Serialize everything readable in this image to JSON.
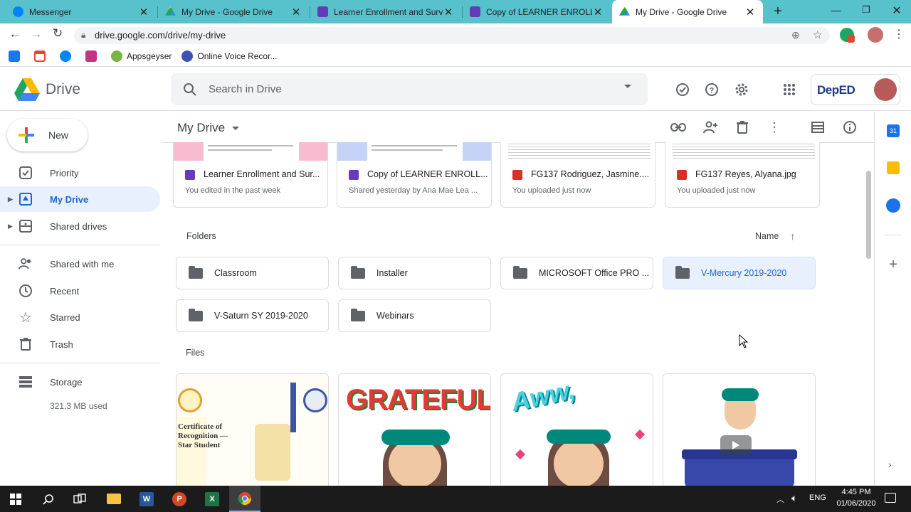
{
  "browser": {
    "tabs": [
      {
        "title": "Messenger",
        "icon": "messenger-icon",
        "color": "#0084ff"
      },
      {
        "title": "My Drive - Google Drive",
        "icon": "drive-icon",
        "color": "#1fa463"
      },
      {
        "title": "Learner Enrollment and Survey",
        "icon": "forms-icon",
        "color": "#673ab7"
      },
      {
        "title": "Copy of LEARNER ENROLLMEN",
        "icon": "forms-icon",
        "color": "#673ab7"
      },
      {
        "title": "My Drive - Google Drive",
        "icon": "drive-icon",
        "color": "#1fa463"
      }
    ],
    "url": "drive.google.com/drive/my-drive",
    "bookmarks": [
      {
        "label": "",
        "icon": "facebook-icon",
        "color": "#1877f2"
      },
      {
        "label": "",
        "icon": "gmail-icon",
        "color": "#ea4335"
      },
      {
        "label": "",
        "icon": "messenger-icon",
        "color": "#0084ff"
      },
      {
        "label": "",
        "icon": "instagram-icon",
        "color": "#c13584"
      },
      {
        "label": "Appsgeyser",
        "icon": "appsgeyser-icon",
        "color": "#7cb342"
      },
      {
        "label": "Online Voice Recor...",
        "icon": "recorder-icon",
        "color": "#3f51b5"
      }
    ]
  },
  "drive": {
    "logo_label": "Drive",
    "search_placeholder": "Search in Drive",
    "account_label": "DepED",
    "new_label": "New",
    "nav": [
      {
        "label": "Priority",
        "icon": "priority-icon"
      },
      {
        "label": "My Drive",
        "icon": "my-drive-icon"
      },
      {
        "label": "Shared drives",
        "icon": "shared-drives-icon"
      },
      {
        "label": "Shared with me",
        "icon": "shared-with-me-icon"
      },
      {
        "label": "Recent",
        "icon": "clock-icon"
      },
      {
        "label": "Starred",
        "icon": "star-icon"
      },
      {
        "label": "Trash",
        "icon": "trash-icon"
      }
    ],
    "storage_label": "Storage",
    "storage_used": "321.3 MB used",
    "location_title": "My Drive",
    "suggested": [
      {
        "name": "Learner Enrollment and Sur...",
        "meta": "You edited in the past week",
        "type": "forms",
        "color": "#673ab7"
      },
      {
        "name": "Copy of LEARNER ENROLL...",
        "meta": "Shared yesterday by Ana Mae Lea ...",
        "type": "forms",
        "color": "#673ab7"
      },
      {
        "name": "FG137 Rodriguez, Jasmine....",
        "meta": "You uploaded just now",
        "type": "image",
        "color": "#d93025"
      },
      {
        "name": "FG137 Reyes, Alyana.jpg",
        "meta": "You uploaded just now",
        "type": "image",
        "color": "#d93025"
      }
    ],
    "folders_label": "Folders",
    "sort_label": "Name",
    "folders": [
      {
        "name": "Classroom"
      },
      {
        "name": "Installer"
      },
      {
        "name": "MICROSOFT Office PRO ..."
      },
      {
        "name": "V-Mercury 2019-2020"
      },
      {
        "name": "V-Saturn SY 2019-2020"
      },
      {
        "name": "Webinars"
      }
    ],
    "files_label": "Files",
    "file_previews": [
      {
        "text": "Certificate of Recognition — Star Student"
      },
      {
        "text": "GRATEFUL"
      },
      {
        "text": "Aww,"
      },
      {
        "text": ""
      }
    ]
  },
  "taskbar": {
    "time": "4:45 PM",
    "date": "01/06/2020",
    "lang": "ENG"
  }
}
